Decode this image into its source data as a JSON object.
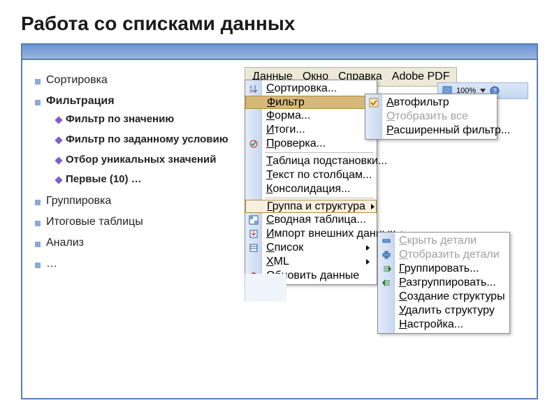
{
  "title": "Работа со списками данных",
  "outline": {
    "items": [
      {
        "label": "Сортировка",
        "bold": false
      },
      {
        "label": "Фильтрация",
        "bold": true
      },
      {
        "label": "Группировка",
        "bold": false
      },
      {
        "label": "Итоговые таблицы",
        "bold": false
      },
      {
        "label": "Анализ",
        "bold": false
      },
      {
        "label": "…",
        "bold": false
      }
    ],
    "filter_sub": [
      "Фильтр по значению",
      "Фильтр по заданному условию",
      "Отбор уникальных значений",
      "Первые (10) …"
    ]
  },
  "menubar": [
    "Данные",
    "Окно",
    "Справка",
    "Adobe PDF"
  ],
  "toolbar": {
    "zoom": "100%"
  },
  "menu_data": {
    "items": [
      {
        "label": "Сортировка...",
        "icon": "sort"
      },
      {
        "label": "Фильтр",
        "submenu": true,
        "highlight": true
      },
      {
        "label": "Форма..."
      },
      {
        "label": "Итоги..."
      },
      {
        "label": "Проверка...",
        "icon": "check"
      },
      {
        "sep": true
      },
      {
        "label": "Таблица подстановки..."
      },
      {
        "label": "Текст по столбцам..."
      },
      {
        "label": "Консолидация..."
      },
      {
        "sep": true
      },
      {
        "label": "Группа и структура",
        "submenu": true,
        "highlight2": true
      },
      {
        "label": "Сводная таблица...",
        "icon": "pivot"
      },
      {
        "label": "Импорт внешних данных",
        "submenu": true,
        "icon": "import"
      },
      {
        "label": "Список",
        "submenu": true,
        "icon": "list"
      },
      {
        "label": "XML",
        "submenu": true
      },
      {
        "label": "Обновить данные",
        "icon": "refresh"
      }
    ]
  },
  "menu_filter": {
    "items": [
      {
        "label": "Автофильтр",
        "checked": true
      },
      {
        "label": "Отобразить все",
        "disabled": true
      },
      {
        "label": "Расширенный фильтр..."
      }
    ]
  },
  "menu_group": {
    "items": [
      {
        "label": "Скрыть детали",
        "disabled": true,
        "icon": "hide"
      },
      {
        "label": "Отобразить детали",
        "disabled": true,
        "icon": "show"
      },
      {
        "label": "Группировать...",
        "icon": "group-right"
      },
      {
        "label": "Разгруппировать...",
        "icon": "group-left"
      },
      {
        "label": "Создание структуры"
      },
      {
        "label": "Удалить структуру"
      },
      {
        "label": "Настройка..."
      }
    ]
  }
}
